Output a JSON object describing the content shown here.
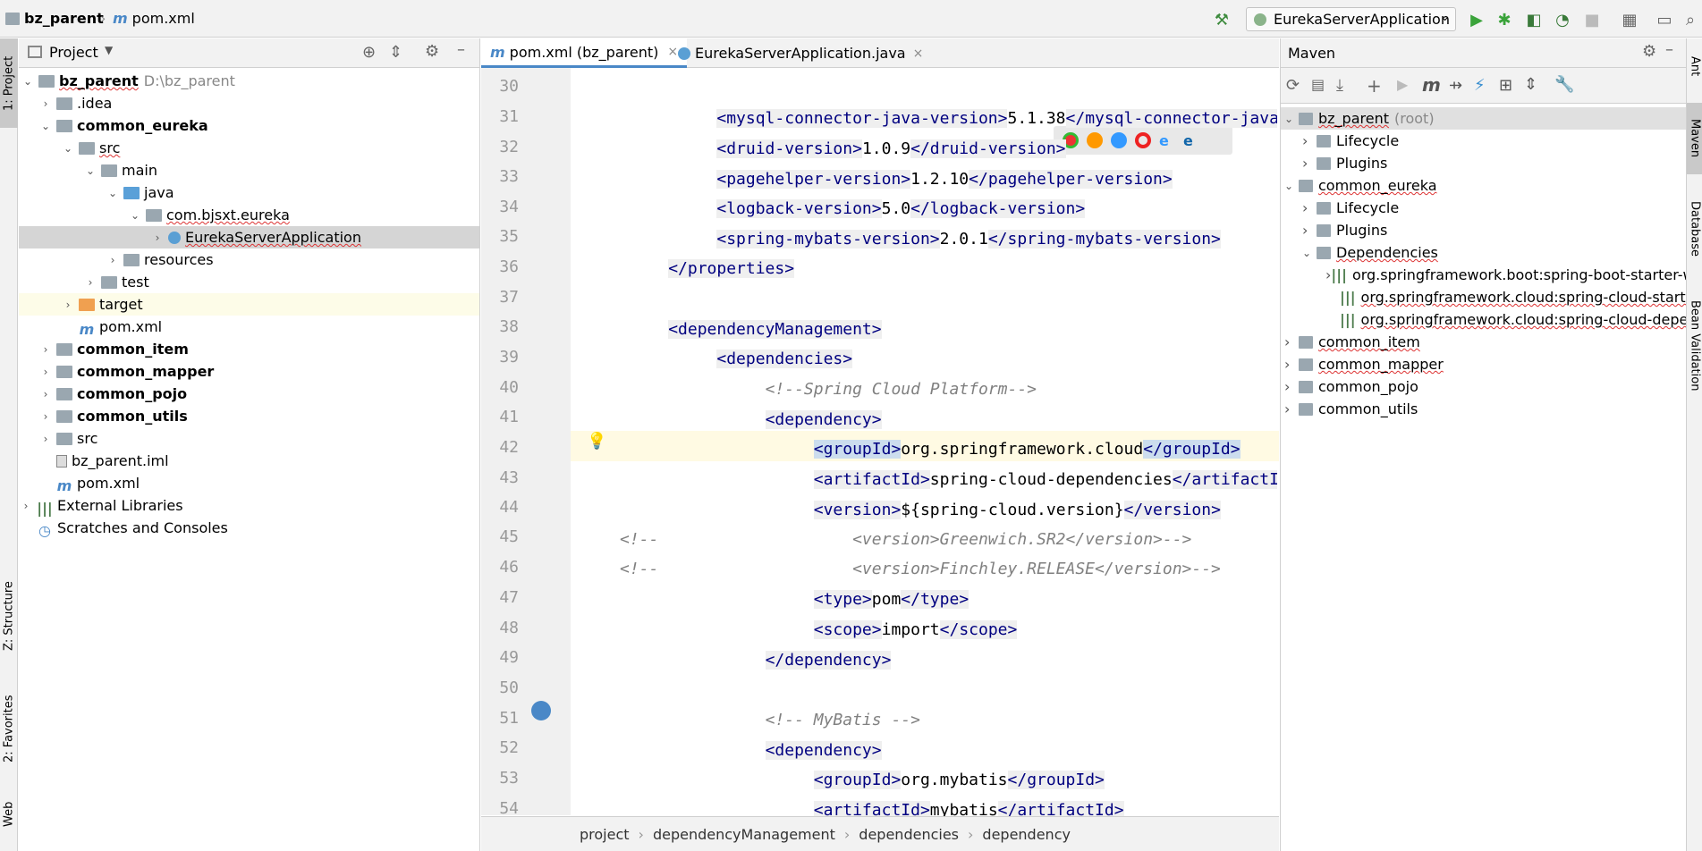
{
  "navbar": {
    "breadcrumb": [
      "bz_parent",
      "pom.xml"
    ],
    "run_config": "EurekaServerApplication"
  },
  "left_strip": {
    "project_tab": "1: Project",
    "structure_tab": "Z: Structure",
    "favorites_tab": "2: Favorites",
    "web_tab": "Web"
  },
  "right_strip": {
    "ant_tab": "Ant",
    "maven_tab": "Maven",
    "database_tab": "Database",
    "bean_tab": "Bean Validation"
  },
  "project": {
    "title": "Project",
    "tree": [
      {
        "label": "bz_parent",
        "hint": "D:\\bz_parent",
        "bold": true
      },
      {
        "label": ".idea"
      },
      {
        "label": "common_eureka",
        "bold": true
      },
      {
        "label": "src"
      },
      {
        "label": "main"
      },
      {
        "label": "java"
      },
      {
        "label": "com.bjsxt.eureka"
      },
      {
        "label": "EurekaServerApplication"
      },
      {
        "label": "resources"
      },
      {
        "label": "test"
      },
      {
        "label": "target"
      },
      {
        "label": "pom.xml"
      },
      {
        "label": "common_item",
        "bold": true
      },
      {
        "label": "common_mapper",
        "bold": true
      },
      {
        "label": "common_pojo",
        "bold": true
      },
      {
        "label": "common_utils",
        "bold": true
      },
      {
        "label": "src"
      },
      {
        "label": "bz_parent.iml"
      },
      {
        "label": "pom.xml"
      },
      {
        "label": "External Libraries"
      },
      {
        "label": "Scratches and Consoles"
      }
    ]
  },
  "editor": {
    "tabs": [
      {
        "label": "pom.xml (bz_parent)"
      },
      {
        "label": "EurekaServerApplication.java"
      }
    ],
    "line_numbers": [
      "30",
      "31",
      "32",
      "33",
      "34",
      "35",
      "36",
      "37",
      "38",
      "39",
      "40",
      "41",
      "42",
      "43",
      "44",
      "45",
      "46",
      "47",
      "48",
      "49",
      "50",
      "51",
      "52",
      "53",
      "54"
    ],
    "breadcrumbs": [
      "project",
      "dependencyManagement",
      "dependencies",
      "dependency"
    ]
  },
  "maven": {
    "title": "Maven",
    "tree": [
      {
        "label": "bz_parent",
        "hint": "(root)"
      },
      {
        "label": "Lifecycle"
      },
      {
        "label": "Plugins"
      },
      {
        "label": "common_eureka"
      },
      {
        "label": "Lifecycle"
      },
      {
        "label": "Plugins"
      },
      {
        "label": "Dependencies"
      },
      {
        "label": "org.springframework.boot:spring-boot-starter-w"
      },
      {
        "label": "org.springframework.cloud:spring-cloud-starter-"
      },
      {
        "label": "org.springframework.cloud:spring-cloud-depenc"
      },
      {
        "label": "common_item"
      },
      {
        "label": "common_mapper"
      },
      {
        "label": "common_pojo"
      },
      {
        "label": "common_utils"
      }
    ]
  }
}
